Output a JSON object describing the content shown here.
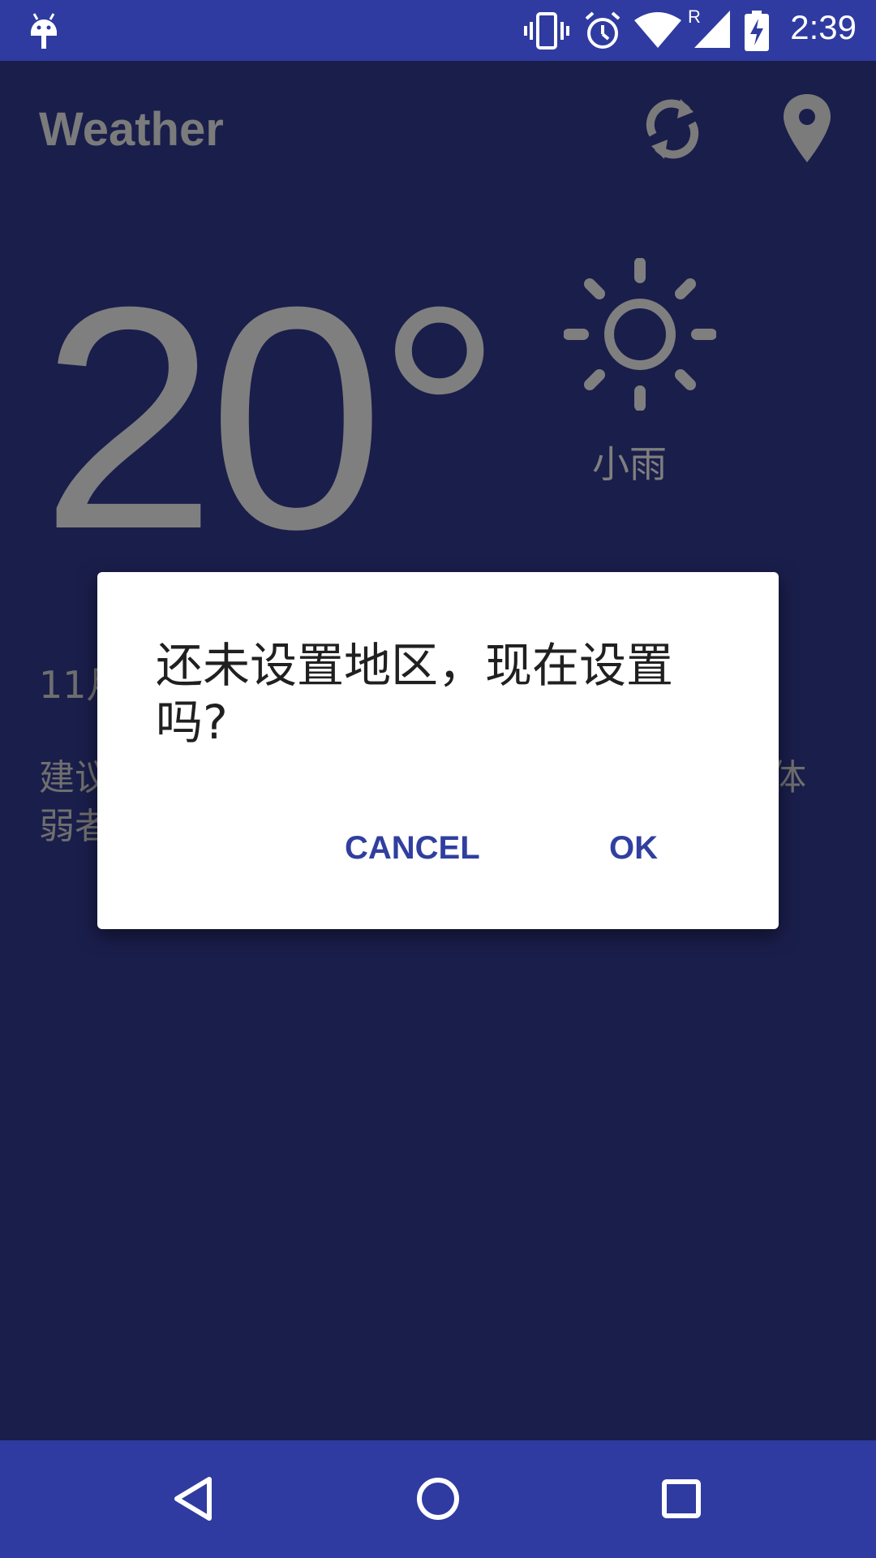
{
  "status_bar": {
    "time": "2:39",
    "icons": [
      "android-icon",
      "vibrate-icon",
      "alarm-icon",
      "wifi-icon",
      "signal-icon",
      "battery-charging-icon"
    ],
    "roaming_indicator": "R"
  },
  "app_bar": {
    "title": "Weather",
    "actions": [
      "refresh-icon",
      "location-pin-icon"
    ]
  },
  "weather": {
    "temperature": "20°",
    "condition": "小雨",
    "condition_icon": "sun-icon"
  },
  "background_text": {
    "date_prefix": "11月",
    "advice_line1_prefix": "建议",
    "advice_line2_prefix": "弱者",
    "advice_line1_suffix": "体"
  },
  "dialog": {
    "message": "还未设置地区，现在设置吗?",
    "cancel_label": "CANCEL",
    "ok_label": "OK"
  },
  "nav_bar": {
    "buttons": [
      "back-icon",
      "home-icon",
      "recents-icon"
    ]
  },
  "colors": {
    "background": "#1a1e4b",
    "bars": "#2f3ba0",
    "accent": "#303f9f",
    "dim_text": "#7f7f7f"
  }
}
